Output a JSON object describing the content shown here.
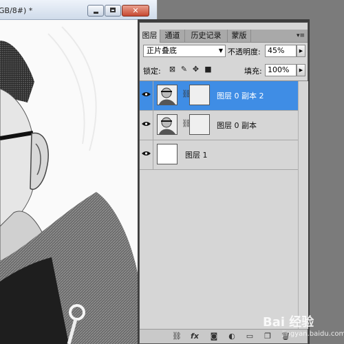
{
  "document": {
    "title": "GB/8#) *",
    "window_buttons": [
      "minimize",
      "maximize",
      "close"
    ]
  },
  "panel": {
    "tabs": [
      "图层",
      "通道",
      "历史记录",
      "蒙版"
    ],
    "active_tab": "图层",
    "blend_mode": "正片叠底",
    "opacity_label": "不透明度:",
    "opacity_value": "45%",
    "lock_label": "锁定:",
    "fill_label": "填充:",
    "fill_value": "100%",
    "layers": [
      {
        "name": "图层 0 副本 2",
        "selected": true
      },
      {
        "name": "图层 0 副本",
        "selected": false
      },
      {
        "name": "图层 1",
        "selected": false
      }
    ],
    "icons": [
      "lock-transparent-icon",
      "lock-paint-icon",
      "lock-move-icon",
      "lock-all-icon"
    ],
    "bottom_icons": [
      "link-layers-icon",
      "fx-icon",
      "add-mask-icon",
      "adjustment-icon",
      "group-icon",
      "new-layer-icon",
      "trash-icon"
    ]
  },
  "watermark": {
    "brand": "Bai 经验",
    "sub": "jingyan.baidu.com"
  }
}
